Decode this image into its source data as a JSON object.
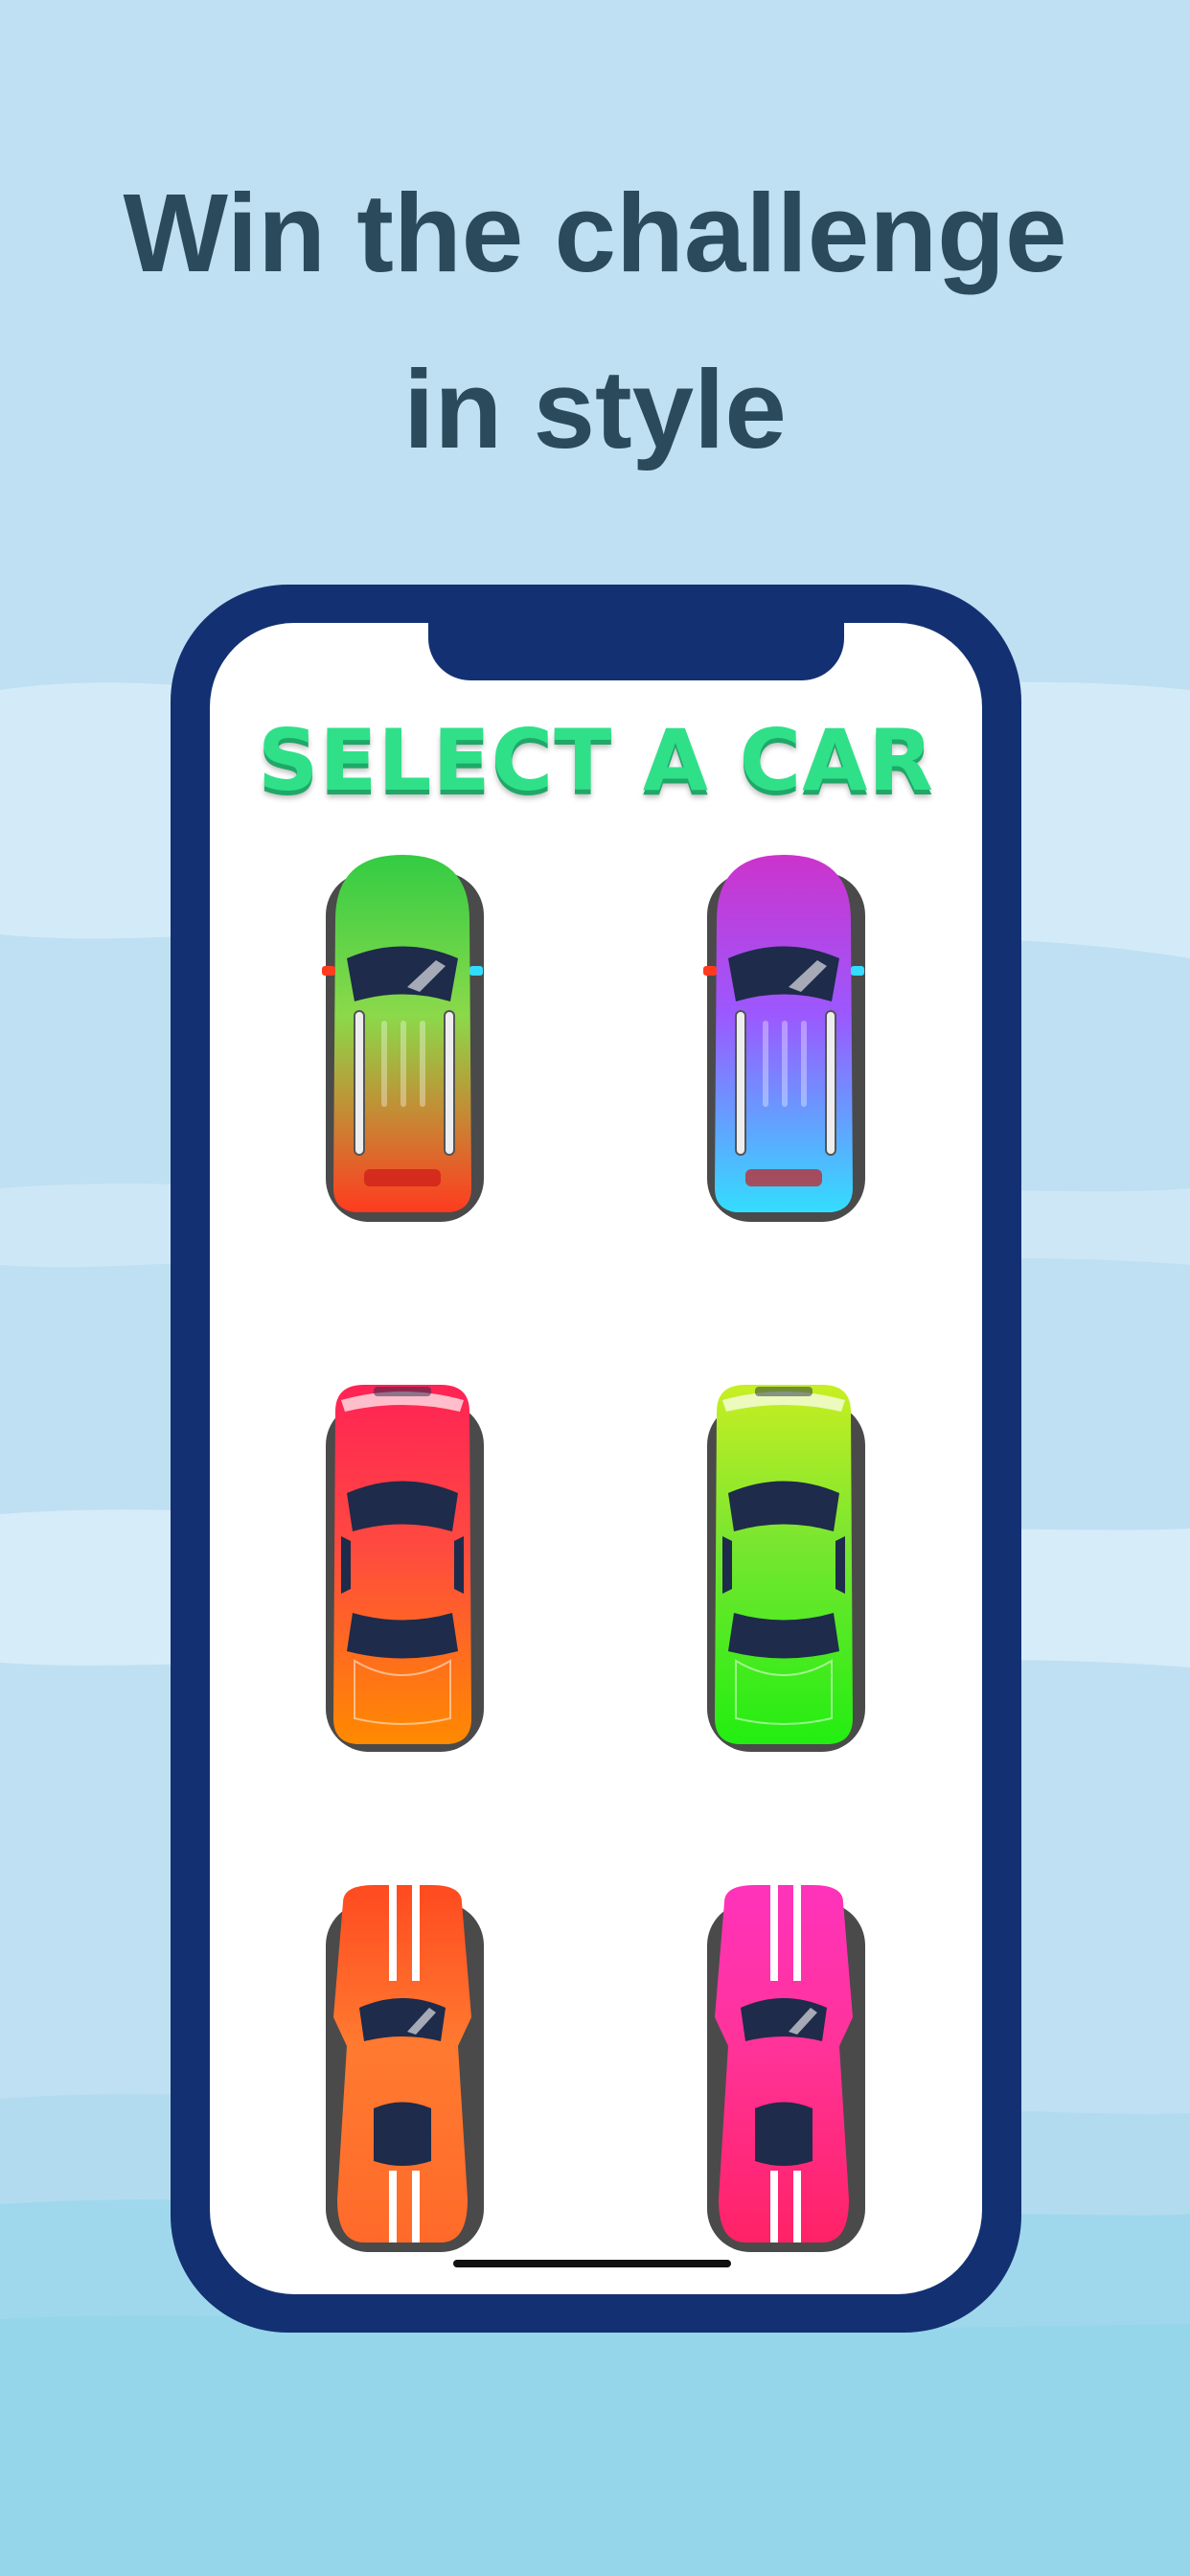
{
  "headline": {
    "line1": "Win the challenge",
    "line2": "in style"
  },
  "screen": {
    "title": "SELECT A CAR"
  },
  "colors": {
    "background_light": "#cfe6f5",
    "background_mid": "#b9dcf1",
    "background_bottom": "#93d6ea",
    "headline_text": "#2b4b5c",
    "phone_frame": "#133172",
    "title_green": "#2fe089"
  },
  "cars": [
    {
      "name": "suv-green-red",
      "style": "suv",
      "top": "#33cc44",
      "bottom": "#ff3b1f",
      "accent": "#8bd94a"
    },
    {
      "name": "suv-purple-cyan",
      "style": "suv",
      "top": "#cc33cc",
      "bottom": "#33ddff",
      "accent": "#9b59ff"
    },
    {
      "name": "sedan-red-orange",
      "style": "sedan",
      "top": "#ff2255",
      "bottom": "#ff8a00",
      "accent": "#ff4a40"
    },
    {
      "name": "sedan-lime-green",
      "style": "sedan",
      "top": "#c8ee22",
      "bottom": "#22ee11",
      "accent": "#77e630"
    },
    {
      "name": "racer-orange",
      "style": "racer",
      "top": "#ff4a20",
      "bottom": "#ff6a2a",
      "accent": "#ff7a30"
    },
    {
      "name": "racer-pink",
      "style": "racer",
      "top": "#ff33bb",
      "bottom": "#ff2266",
      "accent": "#ff3399"
    }
  ]
}
